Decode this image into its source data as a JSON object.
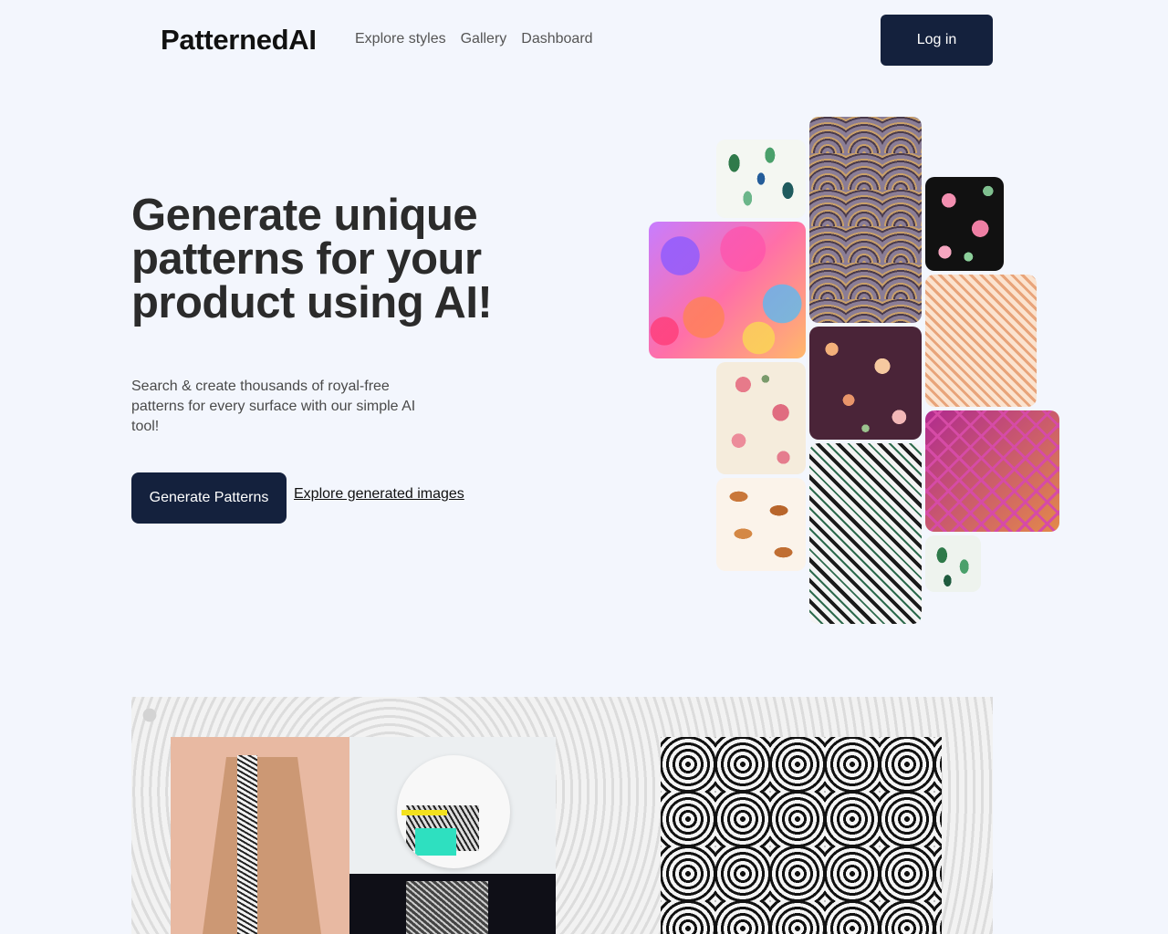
{
  "header": {
    "logo": "PatternedAI",
    "nav": [
      "Explore styles",
      "Gallery",
      "Dashboard"
    ],
    "login_label": "Log in"
  },
  "hero": {
    "title": "Generate unique patterns for your product using AI!",
    "subtitle": "Search & create thousands of royal-free patterns for every surface with our simple AI tool!",
    "primary_cta": "Generate Patterns",
    "secondary_cta": "Explore generated images"
  },
  "colors": {
    "background": "#f3f6fd",
    "primary_button": "#14213d",
    "text": "#2b2b2b"
  }
}
